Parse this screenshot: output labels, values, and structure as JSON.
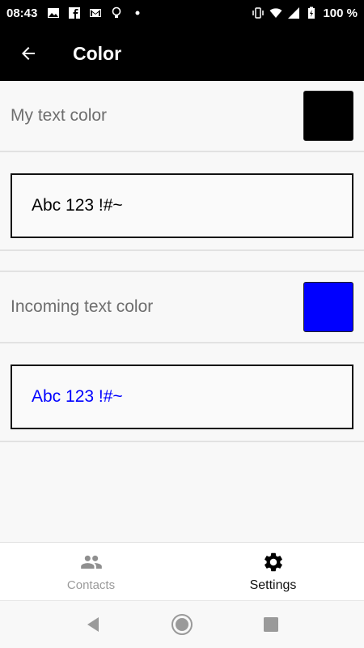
{
  "status_bar": {
    "time": "08:43",
    "battery": "100 %",
    "icons": [
      "image-icon",
      "facebook-icon",
      "gmail-icon",
      "lightbulb-icon",
      "dot-icon",
      "vibrate-icon",
      "wifi-icon",
      "signal-icon",
      "battery-icon"
    ]
  },
  "app_bar": {
    "title": "Color",
    "back_icon": "arrow-back-icon"
  },
  "rows": [
    {
      "label": "My text color",
      "swatch_color": "#000000",
      "preview_text": "Abc 123 !#~",
      "preview_color": "#000000"
    },
    {
      "label": "Incoming text color",
      "swatch_color": "#0000ff",
      "preview_text": "Abc 123 !#~",
      "preview_color": "#0000ff"
    }
  ],
  "bottom_nav": {
    "items": [
      {
        "label": "Contacts",
        "icon": "people-icon",
        "active": false
      },
      {
        "label": "Settings",
        "icon": "gear-icon",
        "active": true
      }
    ]
  },
  "system_nav": [
    "back-triangle-icon",
    "home-circle-icon",
    "recents-square-icon"
  ]
}
